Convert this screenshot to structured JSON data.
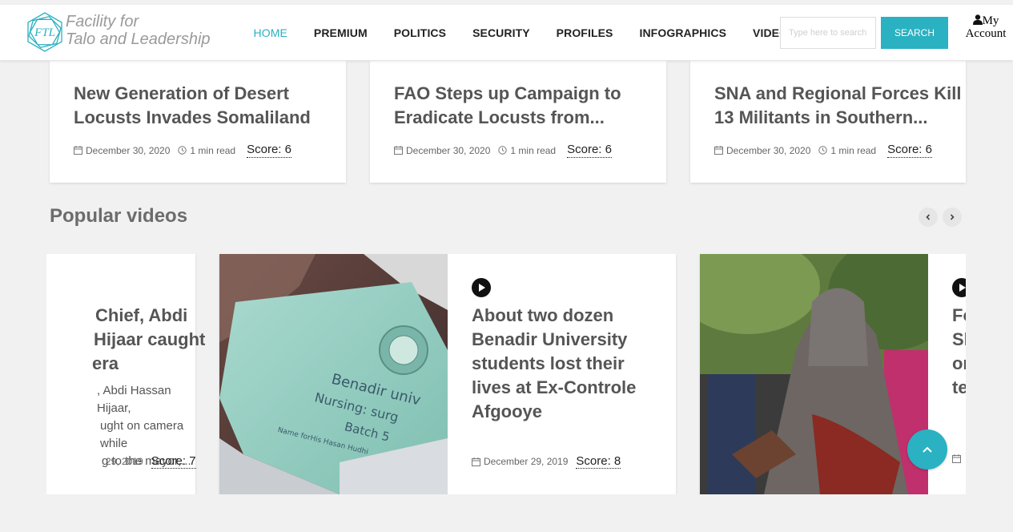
{
  "logo": {
    "mark_text": "FTL",
    "line1": "Facility for",
    "line2": "Talo and Leadership"
  },
  "nav": {
    "items": [
      "HOME",
      "PREMIUM",
      "POLITICS",
      "SECURITY",
      "PROFILES",
      "INFOGRAPHICS",
      "VIDEOS"
    ],
    "active": "HOME"
  },
  "search": {
    "placeholder": "Type here to search",
    "button_label": "SEARCH"
  },
  "account": {
    "label_line1": "My",
    "label_line2": "Account"
  },
  "news_cards": [
    {
      "title": "New Generation of Desert Locusts Invades Somaliland",
      "date": "December 30, 2020",
      "read_time": "1 min read",
      "score": "Score: 6"
    },
    {
      "title": "FAO Steps up Campaign to Eradicate Locusts from...",
      "date": "December 30, 2020",
      "read_time": "1 min read",
      "score": "Score: 6"
    },
    {
      "title": "SNA and Regional Forces Kill 13 Militants in Southern...",
      "date": "December 30, 2020",
      "read_time": "1 min read",
      "score": "Score: 6"
    }
  ],
  "popular_videos": {
    "title": "Popular videos",
    "items": [
      {
        "title_lines": [
          "Chief, Abdi",
          "Hijaar caught",
          "era"
        ],
        "excerpt_lines": [
          ", Abdi Hassan Hijaar,",
          "ught on camera while",
          "g to the mayor,..."
        ],
        "date": "29, 2019",
        "score": "Score: 7"
      },
      {
        "title": "About two dozen Benadir University students lost their lives at Ex-Controle Afgooye",
        "date": "December 29, 2019",
        "score": "Score: 8",
        "thumb_text": [
          "Benadir univ",
          "Nursing: surg",
          "Batch 5",
          "Name forHis   Hasan Hudhi"
        ]
      },
      {
        "title_lines": [
          "Fo",
          "Sh",
          "on",
          "te"
        ]
      }
    ]
  },
  "colors": {
    "accent": "#2ab1c2",
    "text_dark": "#222222",
    "title_gray": "#555555",
    "background": "#f1f1f1"
  },
  "icons": [
    "calendar-icon",
    "clock-icon",
    "play-icon",
    "user-icon",
    "chevron-left-icon",
    "chevron-right-icon",
    "chevron-up-icon"
  ]
}
